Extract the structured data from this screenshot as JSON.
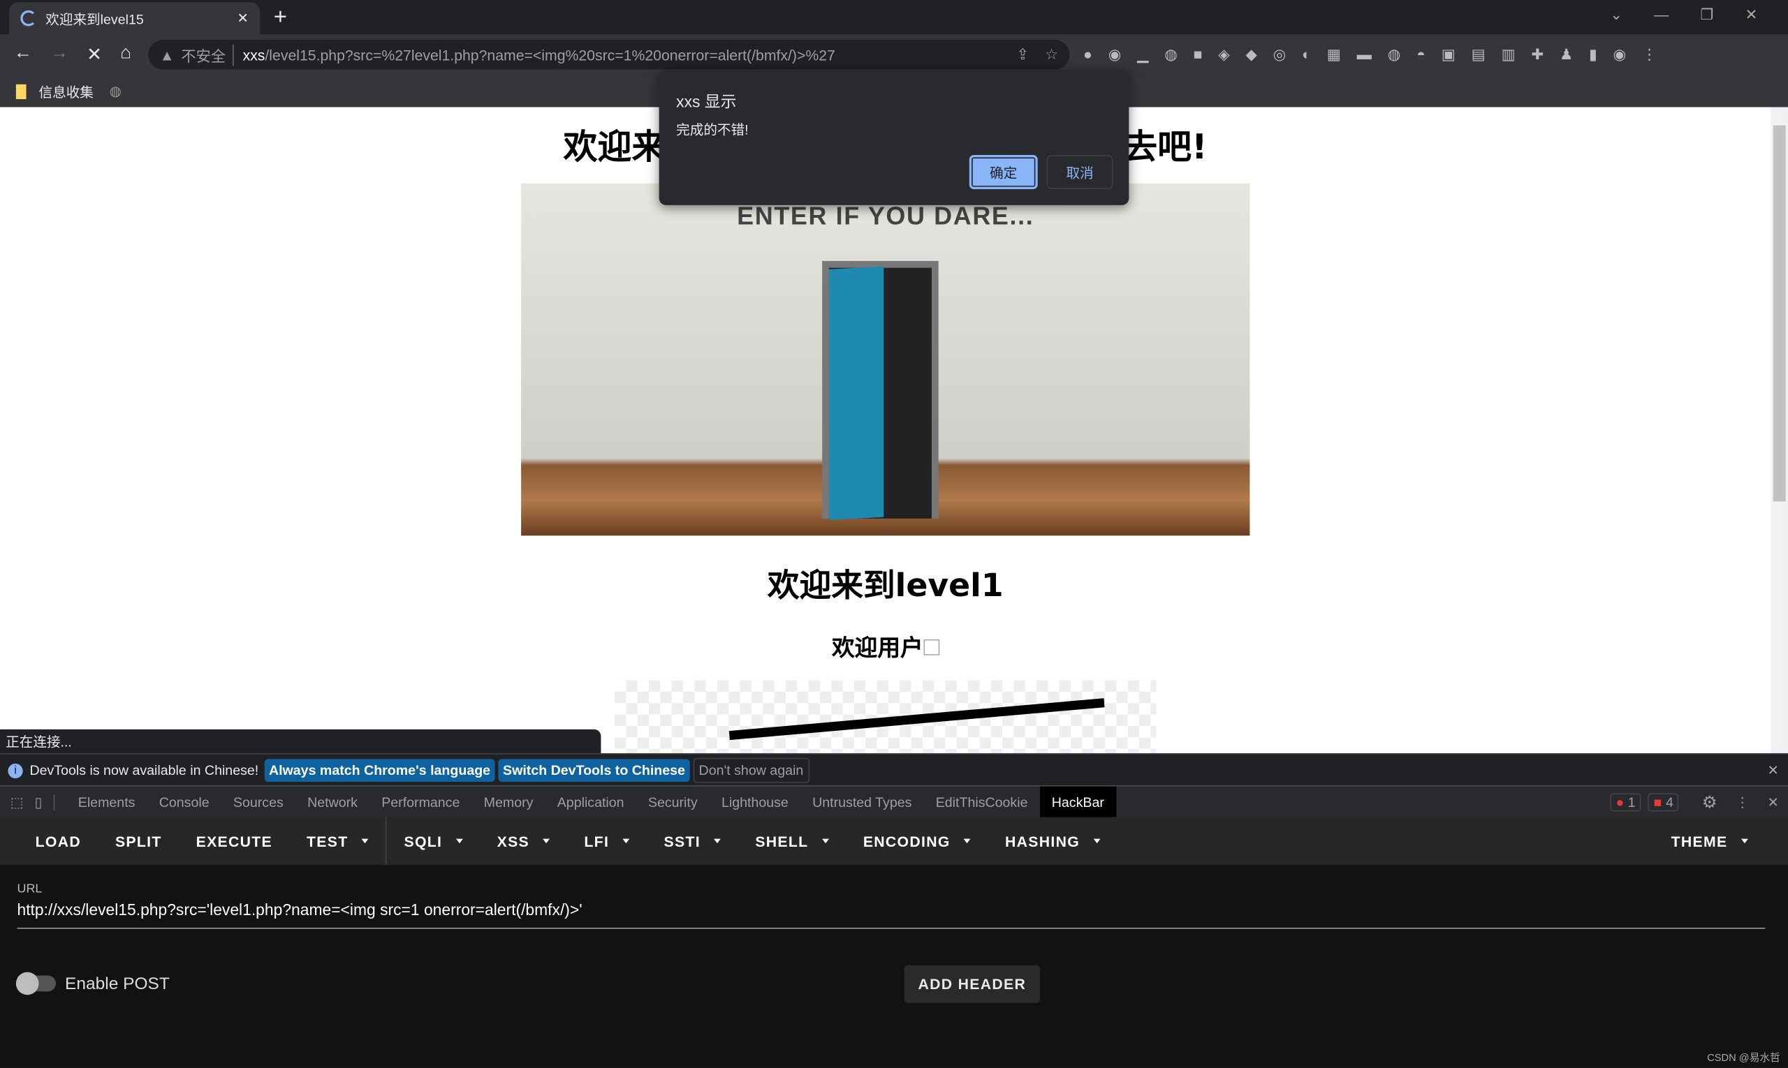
{
  "browser": {
    "tab_title": "欢迎来到level15",
    "security_label": "不安全",
    "url_host": "xxs",
    "url_path": "/level15.php?src=%27level1.php?name=<img%20src=1%20onerror=alert(/bmfx/)>%27",
    "bookmark": "信息收集"
  },
  "dialog": {
    "title": "xxs 显示",
    "message": "完成的不错!",
    "ok": "确定",
    "cancel": "取消",
    "ok_color": "#8ab4f8"
  },
  "page": {
    "heading_left": "欢迎来",
    "heading_right": "去吧!",
    "banner_text": "ENTER IF YOU DARE...",
    "subheading": "欢迎来到level1",
    "welcome_user": "欢迎用户"
  },
  "status": "正在连接...",
  "devtools": {
    "info": {
      "message": "DevTools is now available in Chinese!",
      "btn1": "Always match Chrome's language",
      "btn2": "Switch DevTools to Chinese",
      "btn3": "Don't show again"
    },
    "tabs": [
      "Elements",
      "Console",
      "Sources",
      "Network",
      "Performance",
      "Memory",
      "Application",
      "Security",
      "Lighthouse",
      "Untrusted Types",
      "EditThisCookie",
      "HackBar"
    ],
    "active_tab": "HackBar",
    "errors": "1",
    "issues": "4"
  },
  "hackbar": {
    "menu": [
      "LOAD",
      "SPLIT",
      "EXECUTE",
      "TEST",
      "SQLI",
      "XSS",
      "LFI",
      "SSTI",
      "SHELL",
      "ENCODING",
      "HASHING"
    ],
    "theme": "THEME",
    "url_label": "URL",
    "url_value": "http://xxs/level15.php?src='level1.php?name=<img src=1 onerror=alert(/bmfx/)>'",
    "enable_post": "Enable POST",
    "add_header": "ADD HEADER"
  },
  "watermark": "CSDN @易水哲"
}
